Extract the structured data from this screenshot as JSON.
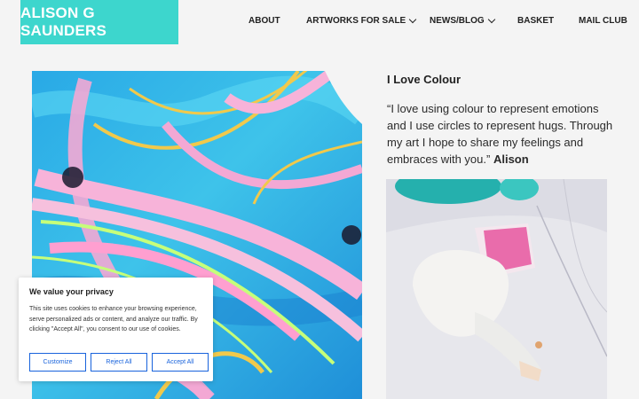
{
  "brand": {
    "logo_text": "ALISON G SAUNDERS",
    "accent": "#3dd6cd"
  },
  "nav": [
    {
      "label": "ABOUT",
      "has_dropdown": false
    },
    {
      "label": "ARTWORKS FOR SALE",
      "has_dropdown": true
    },
    {
      "label": "NEWS/BLOG",
      "has_dropdown": true
    },
    {
      "label": "BASKET",
      "has_dropdown": false
    },
    {
      "label": "MAIL CLUB",
      "has_dropdown": false
    }
  ],
  "content": {
    "headline": "I Love Colour",
    "quote": "“I love using colour to represent emotions and I use circles to represent hugs. Through my art I hope to share my feelings and embraces with you.”",
    "author": "Alison"
  },
  "cookie": {
    "title": "We value your privacy",
    "text": "This site uses cookies to enhance your browsing experience, serve personalized ads or content, and analyze our traffic. By clicking \"Accept All\", you consent to our use of cookies.",
    "customize": "Customize",
    "reject": "Reject All",
    "accept": "Accept All",
    "button_color": "#1863dc"
  },
  "icons": {
    "dropdown": "chevron-down-icon"
  }
}
